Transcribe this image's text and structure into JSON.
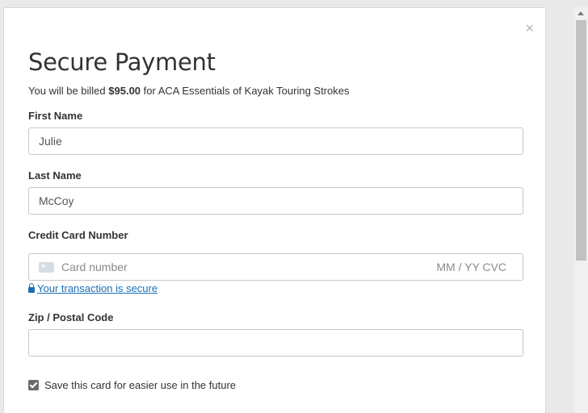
{
  "modal": {
    "close_label": "×",
    "title": "Secure Payment",
    "billing": {
      "prefix": "You will be billed ",
      "amount": "$95.00",
      "suffix": " for ACA Essentials of Kayak Touring Strokes"
    }
  },
  "form": {
    "first_name": {
      "label": "First Name",
      "value": "Julie"
    },
    "last_name": {
      "label": "Last Name",
      "value": "McCoy"
    },
    "card": {
      "label": "Credit Card Number",
      "placeholder": "Card number",
      "expiry_cvc_placeholder": "MM / YY  CVC",
      "icon": "credit-card-icon"
    },
    "secure_link": "Your transaction is secure",
    "zip": {
      "label": "Zip / Postal Code",
      "value": ""
    },
    "save_card": {
      "label": "Save this card for easier use in the future",
      "checked": true
    }
  },
  "colors": {
    "link": "#1a6fb5",
    "text": "#333333"
  }
}
